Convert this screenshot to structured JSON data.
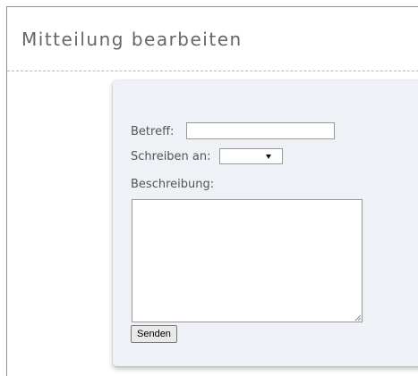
{
  "page": {
    "title": "Mitteilung bearbeiten"
  },
  "form": {
    "subject_label": "Betreff:",
    "subject_value": "",
    "recipient_label": "Schreiben an:",
    "recipient_selected": "",
    "description_label": "Beschreibung:",
    "description_value": "",
    "submit_label": "Senden"
  },
  "colors": {
    "panel_background": "#eef1f5",
    "title_text": "#666666",
    "label_text": "#555555"
  },
  "icons": {
    "dropdown": "chevron-down-icon",
    "resize": "resize-grip-icon"
  }
}
